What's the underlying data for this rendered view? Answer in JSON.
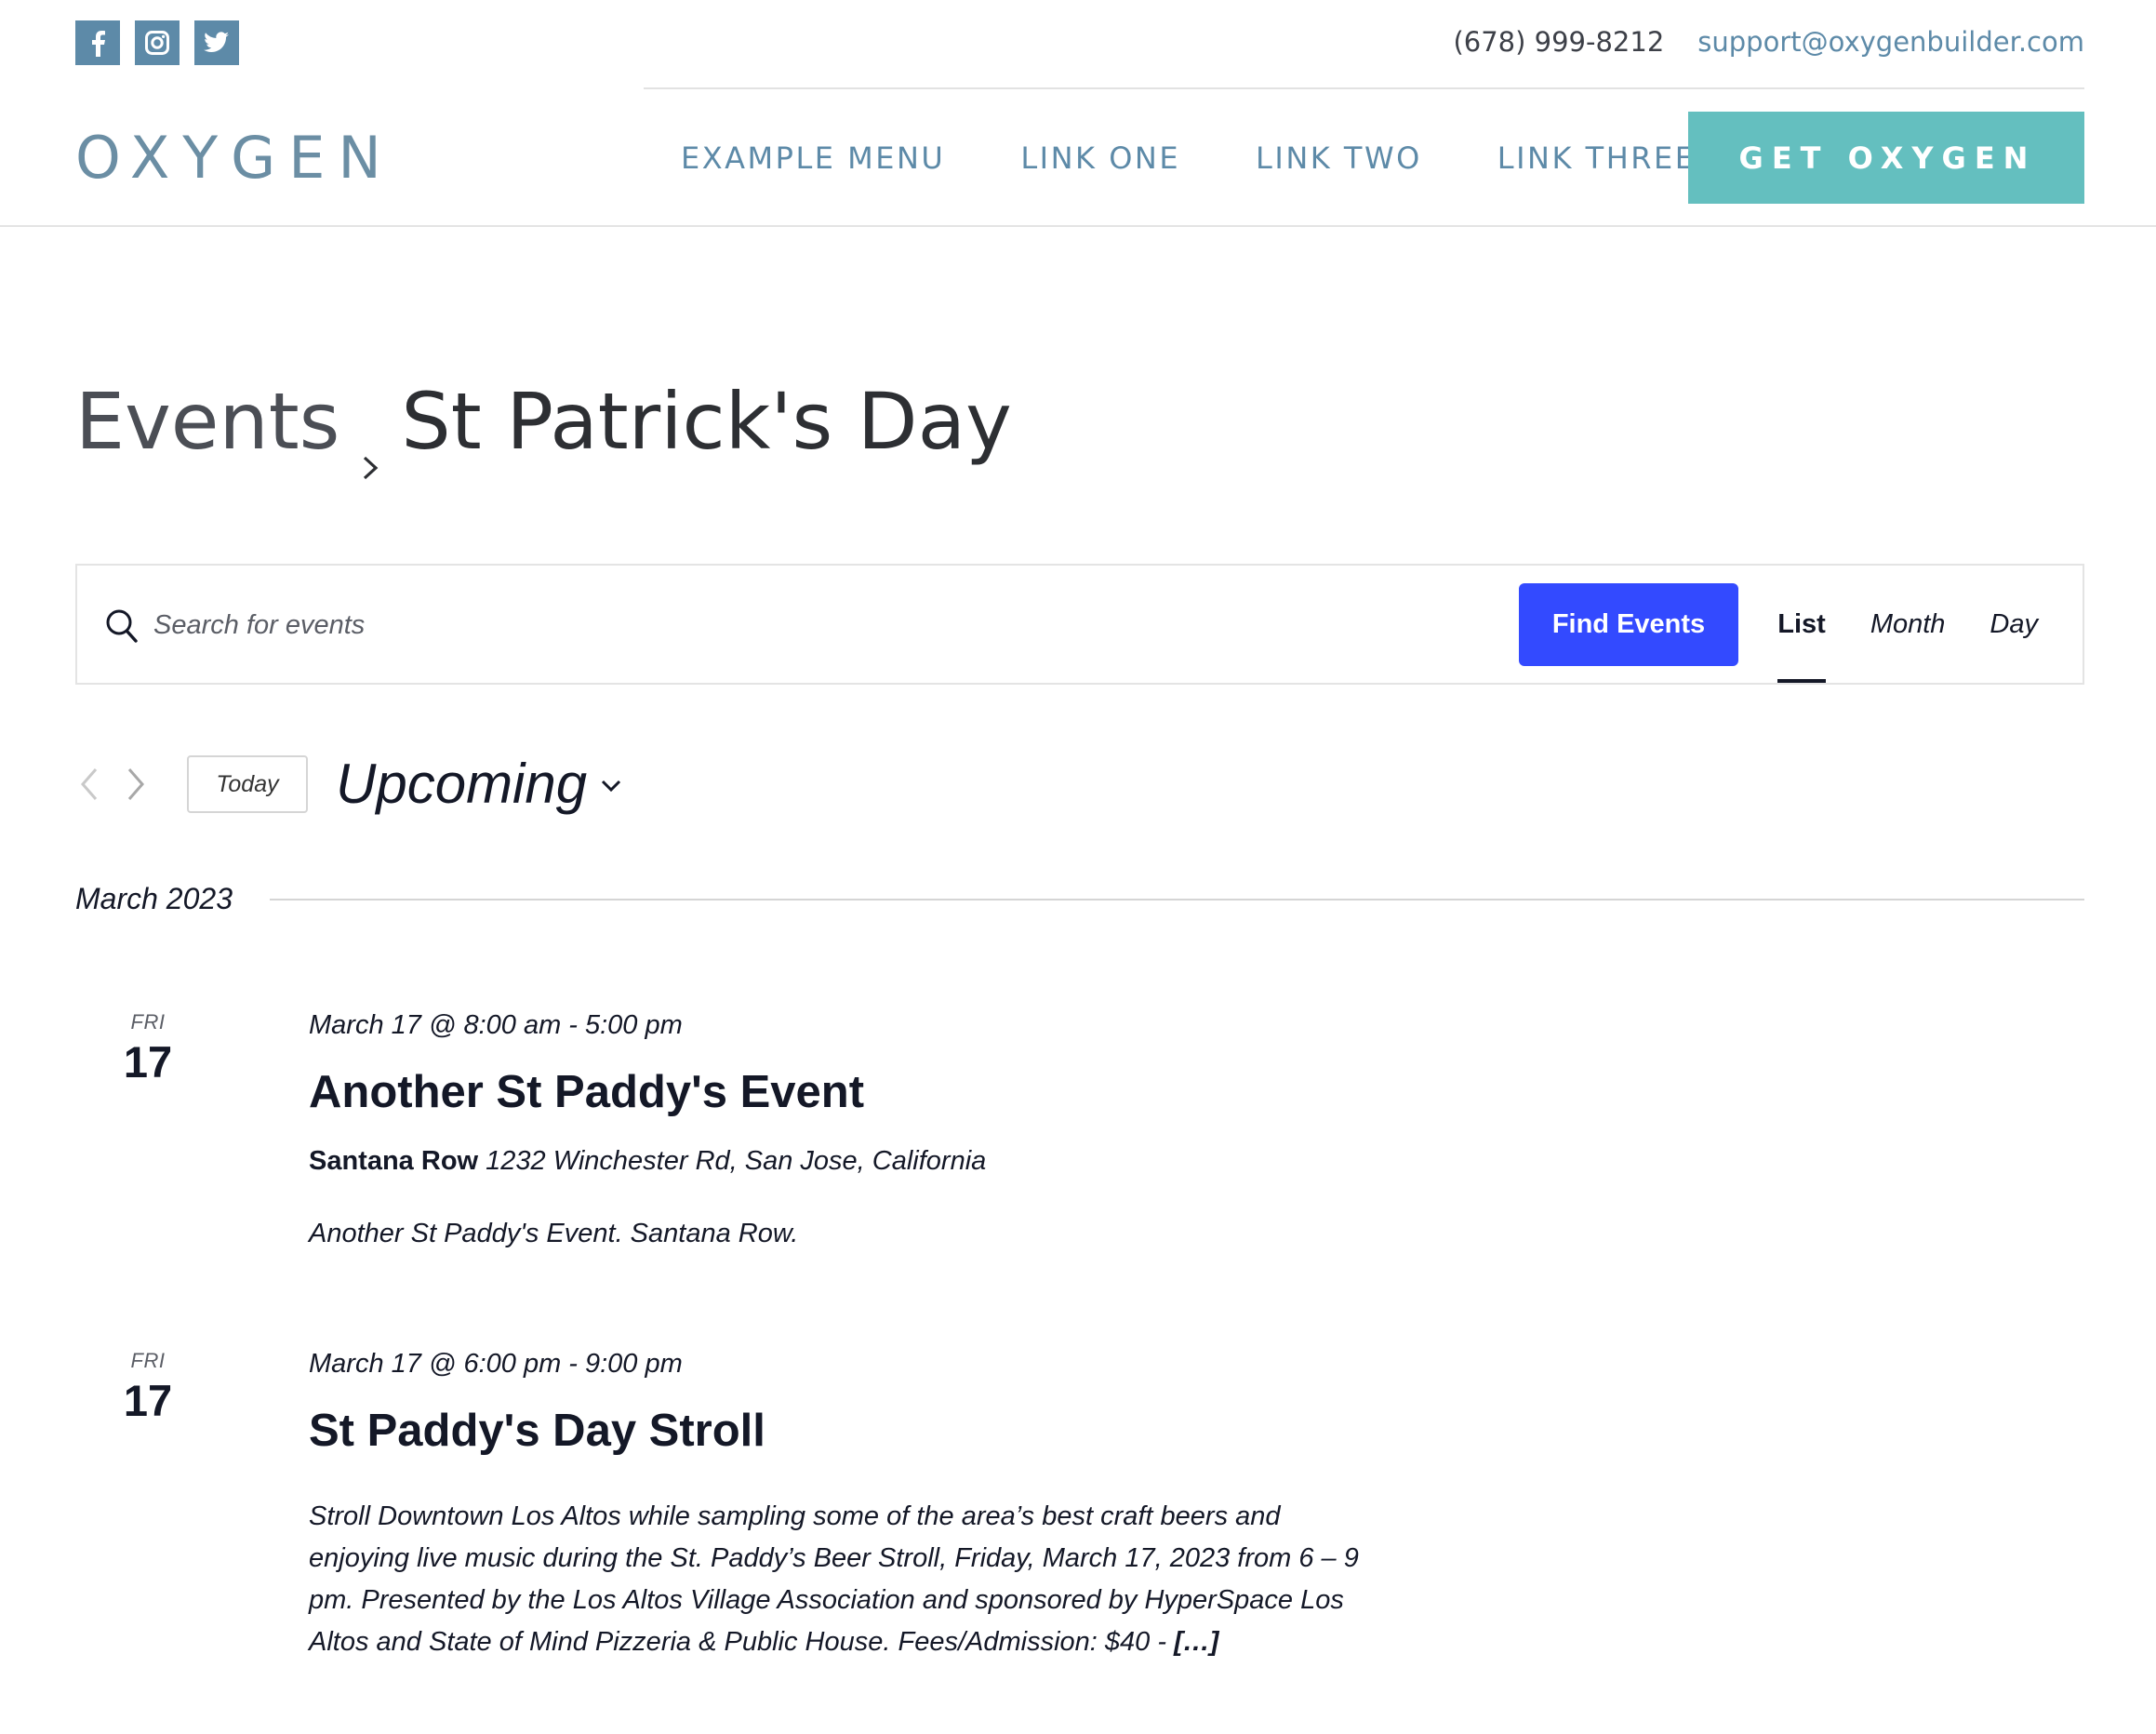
{
  "header": {
    "social": [
      {
        "name": "facebook-icon",
        "glyph": "f"
      },
      {
        "name": "instagram-icon",
        "glyph": "instagram"
      },
      {
        "name": "twitter-icon",
        "glyph": "twitter"
      }
    ],
    "phone": "(678) 999-8212",
    "email": "support@oxygenbuilder.com",
    "logo": "OXYGEN",
    "nav": [
      "EXAMPLE MENU",
      "LINK ONE",
      "LINK TWO",
      "LINK THREE"
    ],
    "cta_label": "GET OXYGEN",
    "colors": {
      "accent": "#5d8aa8",
      "cta": "#64bfbf",
      "find": "#334aff"
    }
  },
  "breadcrumb": {
    "parent": "Events",
    "current": "St Patrick's Day"
  },
  "search": {
    "placeholder": "Search for events",
    "button_label": "Find Events",
    "views": [
      "List",
      "Month",
      "Day"
    ],
    "active_view": "List"
  },
  "datenav": {
    "today_label": "Today",
    "range_label": "Upcoming"
  },
  "month_separator": "March 2023",
  "events": [
    {
      "dow": "FRI",
      "day": "17",
      "time": "March 17 @ 8:00 am - 5:00 pm",
      "title": "Another St Paddy's Event",
      "venue_name": "Santana Row",
      "venue_address": "1232 Winchester Rd, San Jose, California",
      "description": "Another St Paddy's Event. Santana Row."
    },
    {
      "dow": "FRI",
      "day": "17",
      "time": "March 17 @ 6:00 pm - 9:00 pm",
      "title": "St Paddy's Day Stroll",
      "description": "Stroll Downtown Los Altos while sampling some of the area’s best craft beers and enjoying live music during the St. Paddy’s Beer Stroll, Friday, March 17, 2023 from 6 – 9 pm. Presented by the Los Altos Village Association and sponsored by HyperSpace Los Altos and State of Mind Pizzeria & Public House.   Fees/Admission: $40 - ",
      "more_label": "[…]"
    }
  ]
}
